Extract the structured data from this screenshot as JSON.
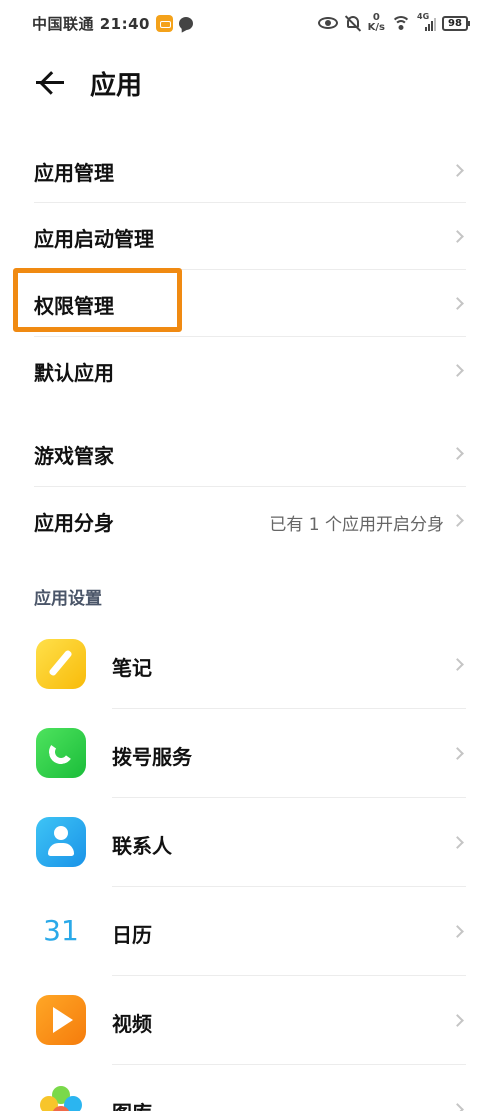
{
  "status_bar": {
    "carrier_time": "中国联通 21:40",
    "speed_value": "0",
    "speed_unit": "K/s",
    "network": "4G",
    "battery": "98"
  },
  "header": {
    "back_icon": "arrow-left-icon",
    "title": "应用"
  },
  "menu": [
    {
      "label": "应用管理"
    },
    {
      "label": "应用启动管理"
    },
    {
      "label": "权限管理"
    },
    {
      "label": "默认应用"
    },
    {
      "label": "游戏管家"
    },
    {
      "label": "应用分身",
      "value": "已有 1 个应用开启分身"
    }
  ],
  "highlight": {
    "target": "权限管理",
    "color": "#f08a12"
  },
  "section": {
    "title": "应用设置"
  },
  "apps": [
    {
      "label": "笔记",
      "icon": "notes-icon"
    },
    {
      "label": "拨号服务",
      "icon": "phone-icon"
    },
    {
      "label": "联系人",
      "icon": "contacts-icon"
    },
    {
      "label": "日历",
      "icon": "calendar-icon",
      "icon_text": "31"
    },
    {
      "label": "视频",
      "icon": "video-icon"
    },
    {
      "label": "图库",
      "icon": "gallery-icon"
    }
  ]
}
